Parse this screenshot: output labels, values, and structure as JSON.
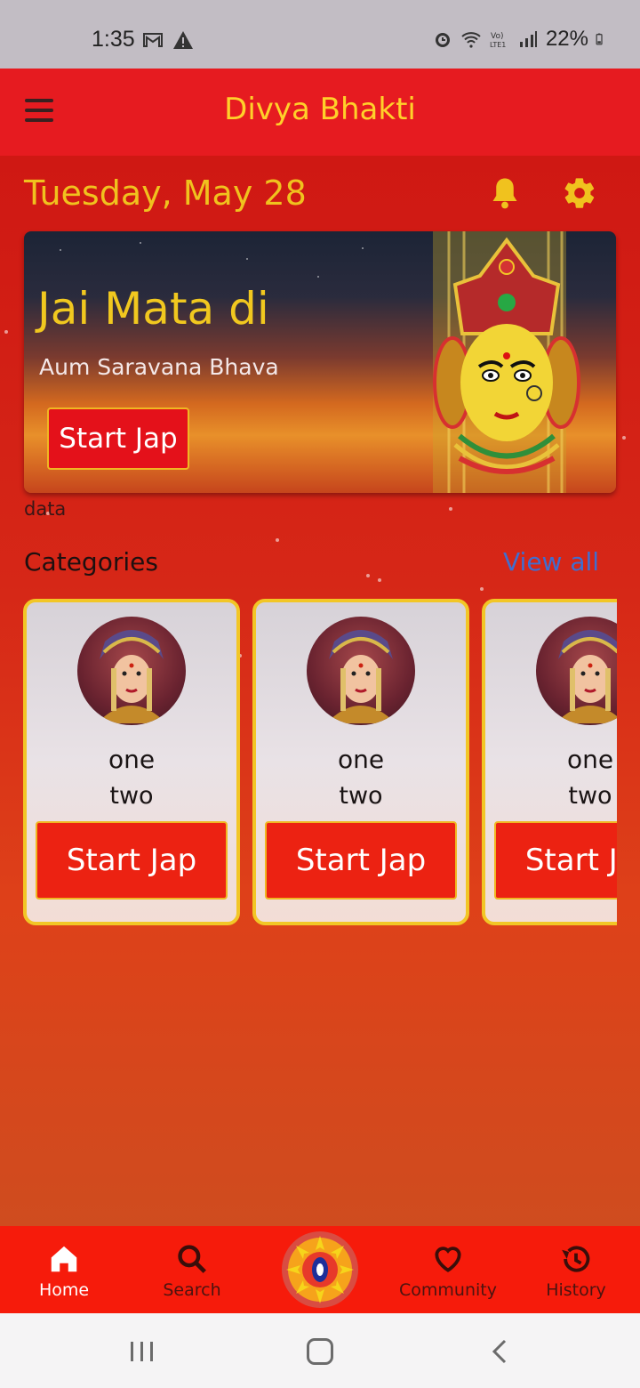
{
  "status_bar": {
    "time": "1:35",
    "battery": "22%",
    "left_icons": [
      "gmail-icon",
      "warning-icon"
    ],
    "right_icons": [
      "alarm-icon",
      "wifi-icon",
      "volte-icon",
      "signal-icon",
      "battery-icon"
    ]
  },
  "app_bar": {
    "title": "Divya Bhakti",
    "menu_icon": "hamburger-menu-icon"
  },
  "header": {
    "date": "Tuesday, May 28",
    "notification_icon": "bell-icon",
    "settings_icon": "gear-icon",
    "accent_color": "#f0c21e"
  },
  "hero": {
    "title": "Jai Mata di",
    "subtitle": "Aum Saravana Bhava",
    "button_label": "Start Jap"
  },
  "data_label": "data",
  "categories": {
    "title": "Categories",
    "view_all_label": "View all",
    "items": [
      {
        "line1": "one",
        "line2": "two",
        "button_label": "Start Jap"
      },
      {
        "line1": "one",
        "line2": "two",
        "button_label": "Start Jap"
      },
      {
        "line1": "one",
        "line2": "two",
        "button_label": "Start Jap"
      }
    ]
  },
  "bottom_nav": {
    "items": [
      {
        "label": "Home",
        "icon": "home-icon",
        "active": true
      },
      {
        "label": "Search",
        "icon": "search-icon",
        "active": false
      },
      {
        "label": "",
        "icon": "sun-logo-icon",
        "active": false
      },
      {
        "label": "Community",
        "icon": "heart-icon",
        "active": false
      },
      {
        "label": "History",
        "icon": "history-icon",
        "active": false
      }
    ]
  },
  "colors": {
    "app_bar": "#e61b20",
    "bottom_nav": "#f61b0b",
    "card_border": "#f2c626",
    "button": "#ec2212",
    "link": "#3f6ed0"
  }
}
